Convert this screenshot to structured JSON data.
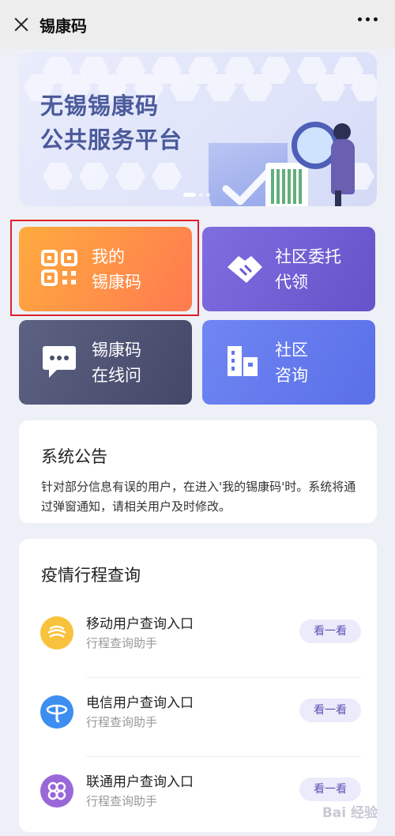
{
  "header": {
    "title": "锡康码"
  },
  "banner": {
    "line1": "无锡锡康码",
    "line2": "公共服务平台"
  },
  "tiles": [
    {
      "line1": "我的",
      "line2": "锡康码"
    },
    {
      "line1": "社区委托",
      "line2": "代领"
    },
    {
      "line1": "锡康码",
      "line2": "在线问"
    },
    {
      "line1": "社区",
      "line2": "咨询"
    }
  ],
  "notice": {
    "title": "系统公告",
    "body": "针对部分信息有误的用户，在进入'我的锡康码'时。系统将通过弹窗通知，请相关用户及时修改。"
  },
  "trip": {
    "title": "疫情行程查询",
    "items": [
      {
        "name": "移动用户查询入口",
        "sub": "行程查询助手",
        "button": "看一看",
        "color": "#f9c23c"
      },
      {
        "name": "电信用户查询入口",
        "sub": "行程查询助手",
        "button": "看一看",
        "color": "#3d8ef0"
      },
      {
        "name": "联通用户查询入口",
        "sub": "行程查询助手",
        "button": "看一看",
        "color": "#9a67d8"
      }
    ]
  },
  "watermark": "Bai 经验"
}
